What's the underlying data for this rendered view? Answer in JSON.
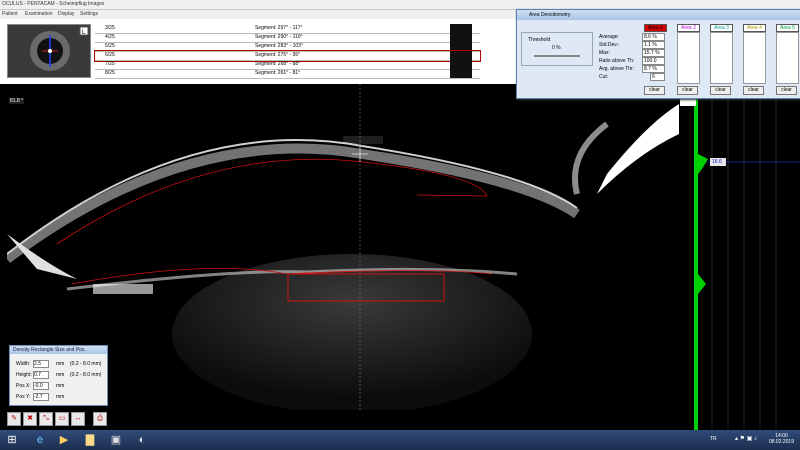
{
  "window": {
    "title": "OCULUS - PENTACAM - Scheimpflug Images",
    "menus": [
      "Patient",
      "Examination",
      "Display",
      "Settings"
    ]
  },
  "segments": [
    {
      "num": "3/25",
      "segment": "Segment: 297° - 117°"
    },
    {
      "num": "4/25",
      "segment": "Segment: 290° - 110°"
    },
    {
      "num": "5/25",
      "segment": "Segment: 283° - 103°"
    },
    {
      "num": "6/25",
      "segment": "Segment: 275° - 95°",
      "selected": true
    },
    {
      "num": "7/25",
      "segment": "Segment: 268° - 88°"
    },
    {
      "num": "8/25",
      "segment": "Segment: 261° - 81°"
    }
  ],
  "scan": {
    "corner_value": "81.8 °",
    "graph_value": "16.6"
  },
  "density": {
    "title": "Area Densitometry",
    "threshold_label": "Threshold",
    "threshold_value": "0 %",
    "areas": [
      {
        "label": "Area 1",
        "color": "#d20000"
      },
      {
        "label": "Area 2",
        "color": "#b000d0"
      },
      {
        "label": "Area 3",
        "color": "#00b0b0"
      },
      {
        "label": "Area 4",
        "color": "#d8c800"
      },
      {
        "label": "Area 5",
        "color": "#00c040"
      }
    ],
    "rows": [
      {
        "label": "Average:",
        "value": "8.6 %"
      },
      {
        "label": "Std.Dev.:",
        "value": "1.1 %"
      },
      {
        "label": "Max:",
        "value": "15.7 %"
      },
      {
        "label": "Ratio above Th:",
        "value": "100.0"
      },
      {
        "label": "Avg. above Thr:",
        "value": "8.7 %"
      },
      {
        "label": "Cut:",
        "value": "6"
      }
    ],
    "clear_label": "clear"
  },
  "rect_dialog": {
    "title": "Density Rectangle Size and Pos.",
    "fields": [
      {
        "label": "Width:",
        "value": "2.5",
        "unit": "mm",
        "range": "(0.2 - 8.0 mm)"
      },
      {
        "label": "Height:",
        "value": "0.7",
        "unit": "mm",
        "range": "(0.2 - 8.0 mm)"
      },
      {
        "label": "Pos X:",
        "value": "-0.0",
        "unit": "mm",
        "range": ""
      },
      {
        "label": "Pos Y:",
        "value": "-2.7",
        "unit": "mm",
        "range": ""
      }
    ]
  },
  "taskbar": {
    "lang": "TR",
    "time": "14:00",
    "date": "08.02.2019"
  },
  "icons": {
    "start": "windows-start-icon",
    "ie": "internet-explorer-icon",
    "media": "media-player-icon",
    "folder": "folder-icon",
    "pentacam": "pentacam-icon",
    "scan": "scan-app-icon"
  }
}
